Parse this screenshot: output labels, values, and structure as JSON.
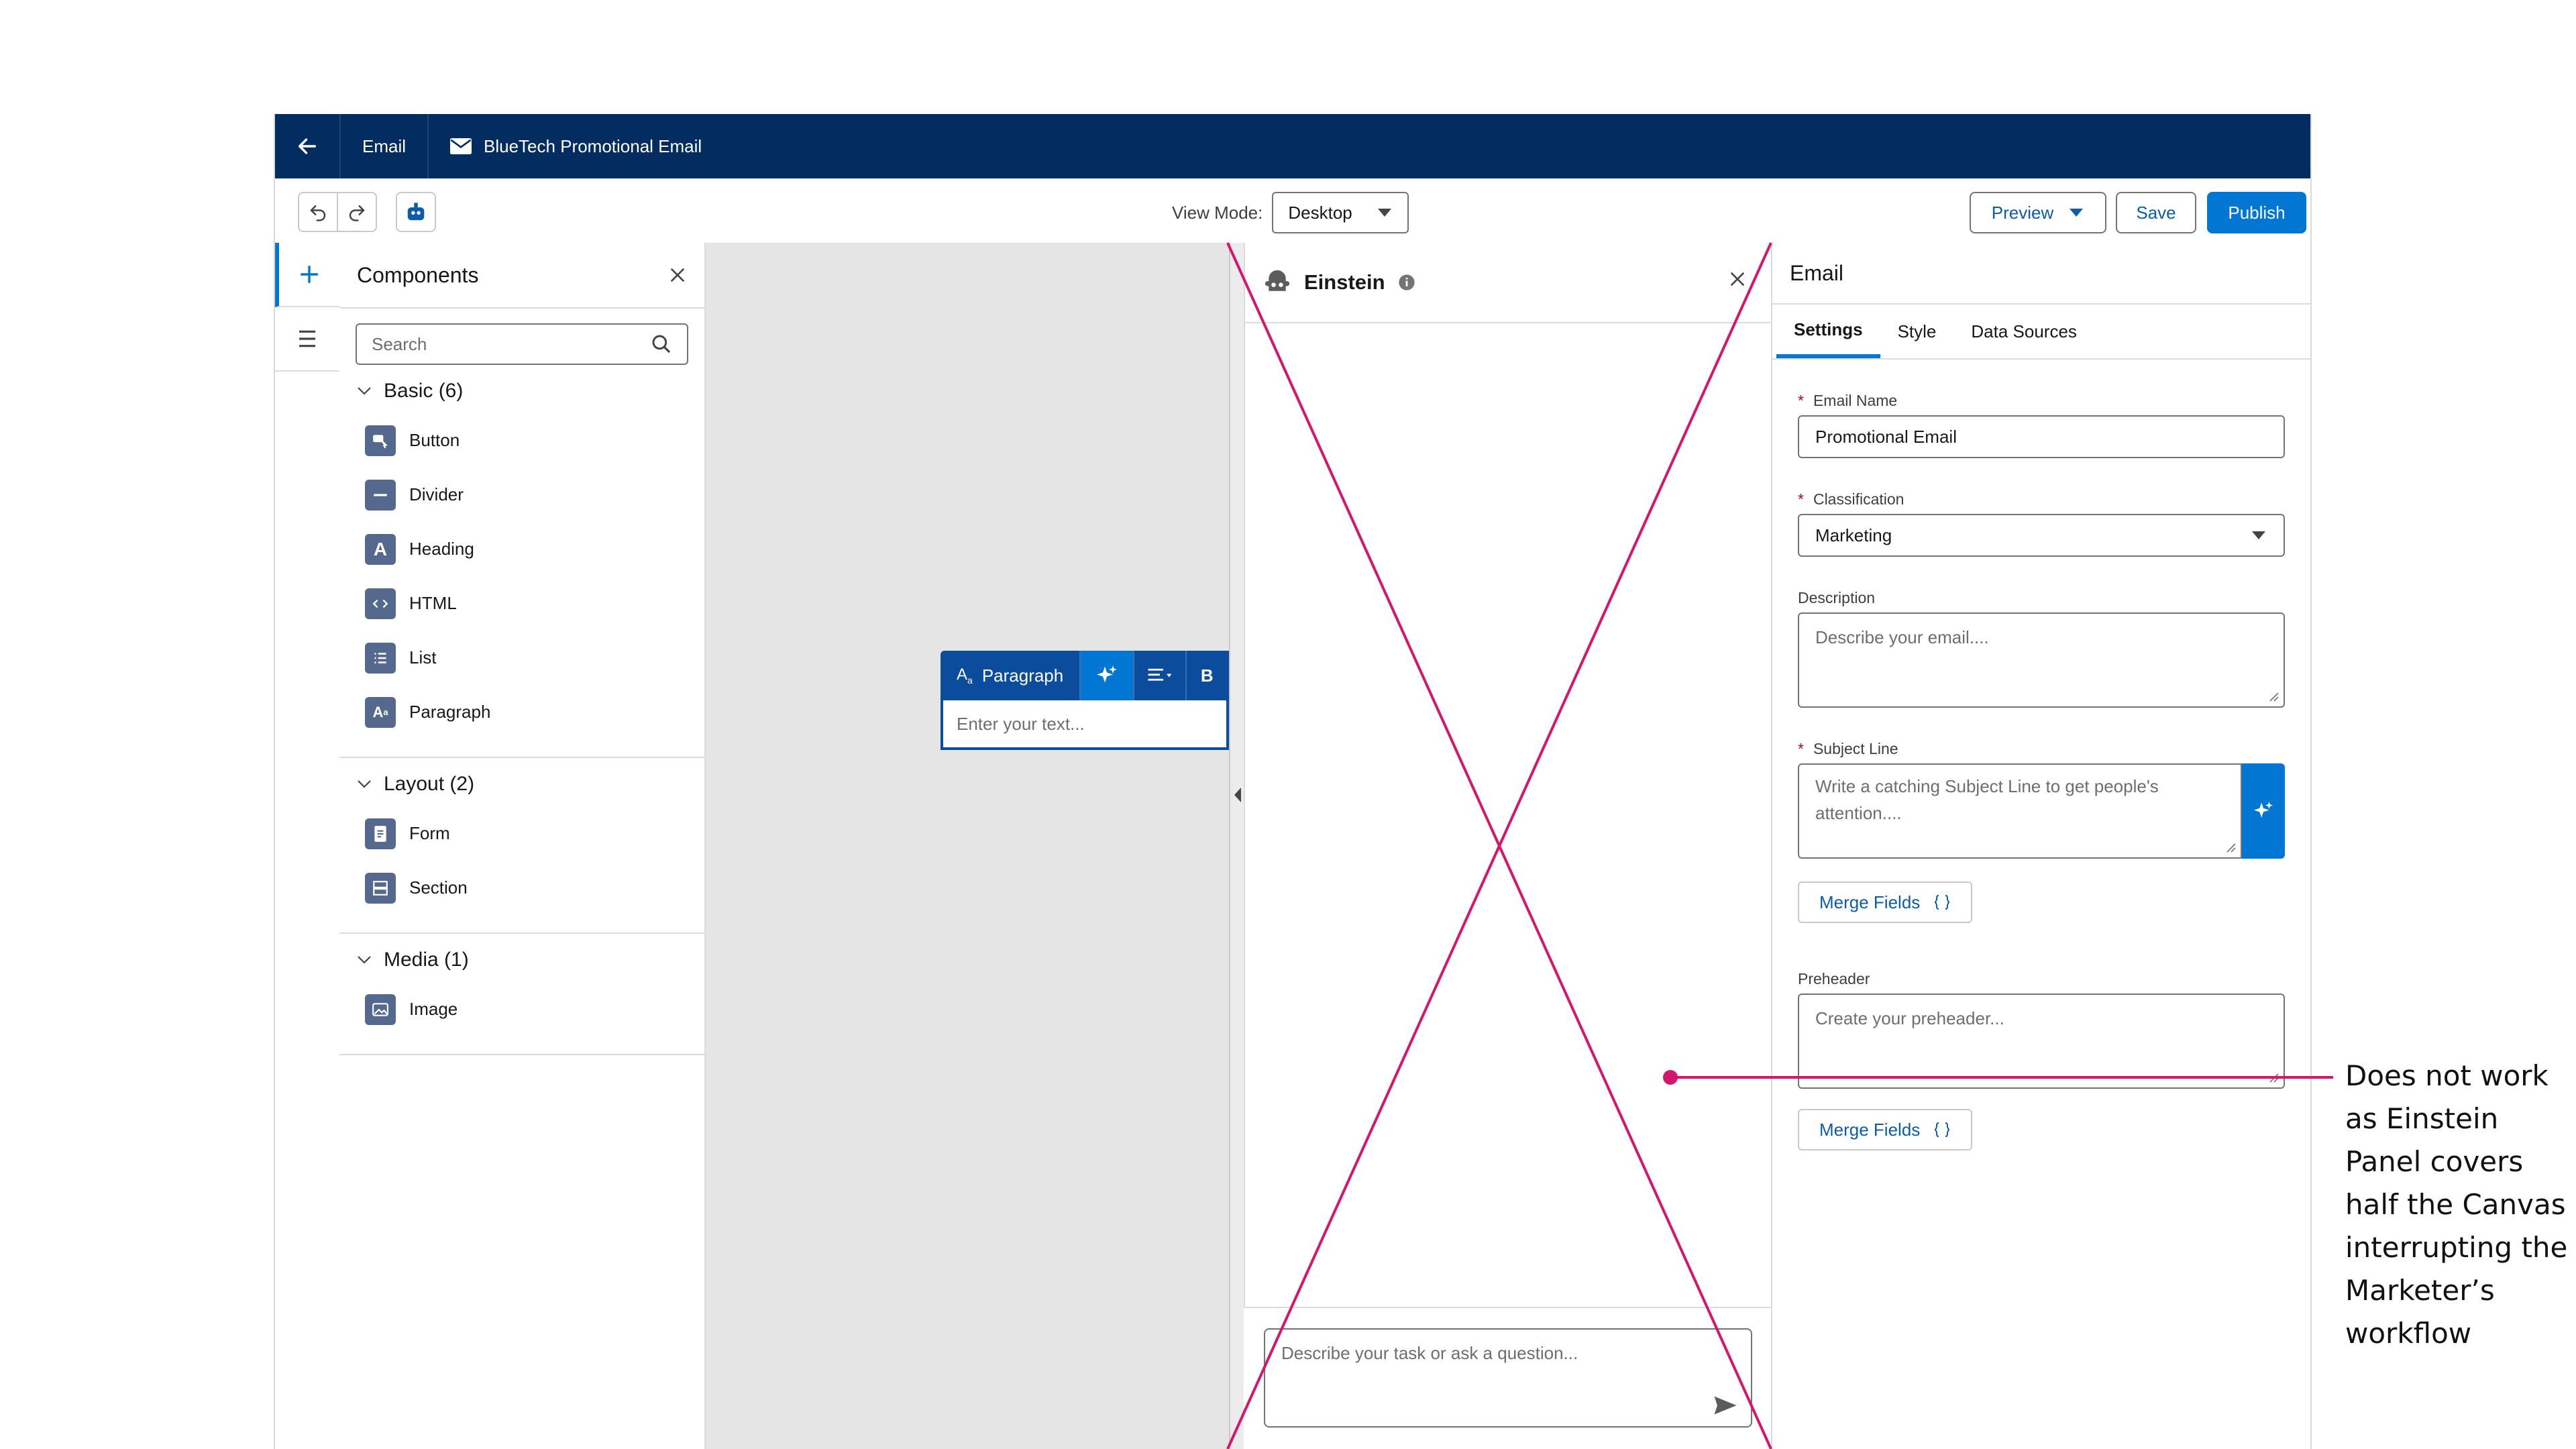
{
  "nav": {
    "breadcrumb_email": "Email",
    "breadcrumb_current": "BlueTech Promotional Email",
    "icons": {
      "back": "arrow-left-icon",
      "email": "envelope-icon"
    }
  },
  "toolbar": {
    "view_mode_label": "View Mode:",
    "view_mode_value": "Desktop",
    "preview_label": "Preview",
    "save_label": "Save",
    "publish_label": "Publish",
    "icons": {
      "undo": "undo-icon",
      "redo": "redo-icon",
      "einstein": "einstein-robot-icon"
    }
  },
  "components": {
    "title": "Components",
    "search_placeholder": "Search",
    "groups": [
      {
        "title": "Basic (6)",
        "items": [
          "Button",
          "Divider",
          "Heading",
          "HTML",
          "List",
          "Paragraph"
        ]
      },
      {
        "title": "Layout (2)",
        "items": [
          "Form",
          "Section"
        ]
      },
      {
        "title": "Media (1)",
        "items": [
          "Image"
        ]
      }
    ]
  },
  "canvas": {
    "paragraph_label": "Paragraph",
    "paragraph_placeholder": "Enter your text..."
  },
  "einstein": {
    "title": "Einstein",
    "input_placeholder": "Describe your task or ask a question..."
  },
  "props": {
    "title": "Email",
    "tabs": [
      "Settings",
      "Style",
      "Data Sources"
    ],
    "active_tab": "Settings",
    "email_name_label": "Email Name",
    "email_name_value": "Promotional Email",
    "classification_label": "Classification",
    "classification_value": "Marketing",
    "description_label": "Description",
    "description_placeholder": "Describe your email....",
    "subject_label": "Subject Line",
    "subject_placeholder": "Write a catching Subject Line to get people's attention....",
    "merge_fields_label": "Merge Fields",
    "preheader_label": "Preheader",
    "preheader_placeholder": "Create your preheader..."
  },
  "annotation": {
    "text": "Does not work as Einstein Panel covers half the Canvas interrupting the Marketer’s workflow"
  },
  "colors": {
    "nav_bg": "#032d60",
    "brand": "#0176d3",
    "annotation": "#d6156c"
  }
}
